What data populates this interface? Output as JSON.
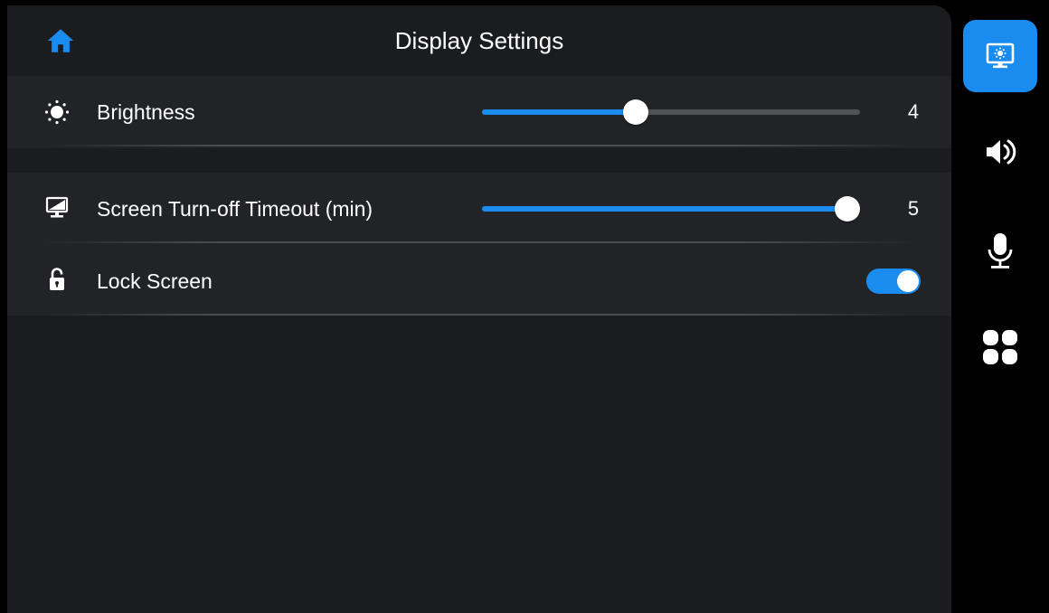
{
  "header": {
    "title": "Display Settings",
    "home_icon": "home-icon"
  },
  "settings": {
    "brightness": {
      "label": "Brightness",
      "icon": "sun-icon",
      "value": "4",
      "level": 4,
      "max": 10
    },
    "timeout": {
      "label": "Screen Turn-off Timeout (min)",
      "icon": "monitor-icon",
      "value": "5",
      "level": 5,
      "max": 5
    },
    "lock_screen": {
      "label": "Lock Screen",
      "icon": "unlock-icon",
      "enabled": true
    }
  },
  "side_nav": [
    {
      "name": "display",
      "icon": "display-settings-icon",
      "active": true
    },
    {
      "name": "sound",
      "icon": "speaker-icon",
      "active": false
    },
    {
      "name": "microphone",
      "icon": "microphone-icon",
      "active": false
    },
    {
      "name": "apps",
      "icon": "apps-grid-icon",
      "active": false
    }
  ],
  "colors": {
    "accent": "#1a8cf0",
    "panel": "#1b1c1f",
    "group": "#222327",
    "track": "#4f5257",
    "text": "#ffffff"
  }
}
